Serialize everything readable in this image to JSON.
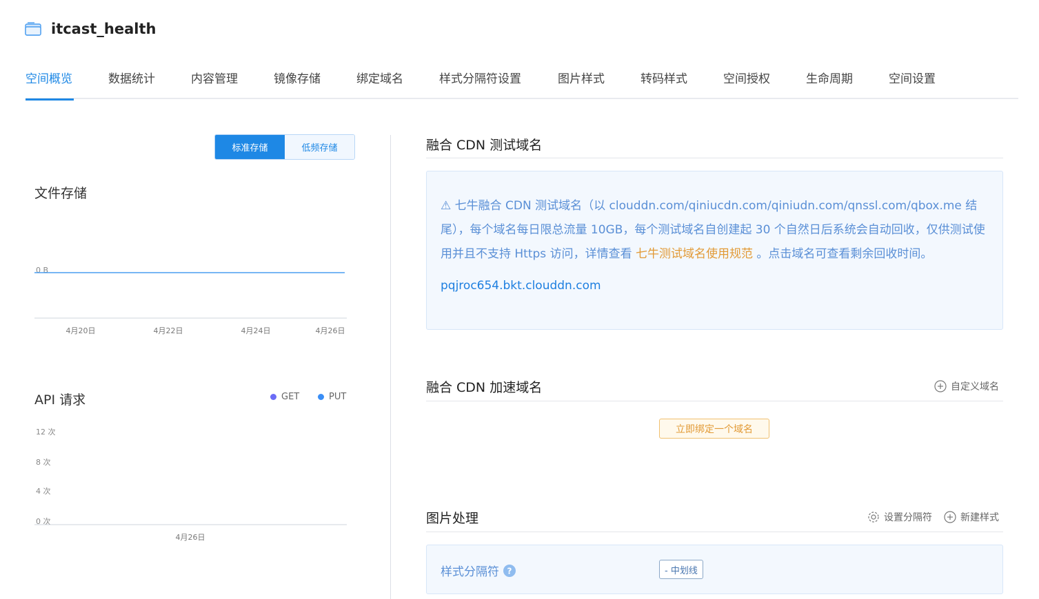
{
  "bucket": {
    "name": "itcast_health",
    "icon": "bucket-icon"
  },
  "tabs": [
    {
      "label": "空间概览",
      "active": true
    },
    {
      "label": "数据统计"
    },
    {
      "label": "内容管理"
    },
    {
      "label": "镜像存储"
    },
    {
      "label": "绑定域名"
    },
    {
      "label": "样式分隔符设置"
    },
    {
      "label": "图片样式"
    },
    {
      "label": "转码样式"
    },
    {
      "label": "空间授权"
    },
    {
      "label": "生命周期"
    },
    {
      "label": "空间设置"
    }
  ],
  "storage_toggle": {
    "standard": "标准存储",
    "low_freq": "低频存储",
    "selected": "标准存储"
  },
  "file_storage": {
    "title": "文件存储"
  },
  "api_requests": {
    "title": "API 请求",
    "legend": [
      {
        "name": "GET",
        "color": "#6b6cf6"
      },
      {
        "name": "PUT",
        "color": "#3a8ef6"
      }
    ]
  },
  "chart_data": [
    {
      "type": "line",
      "title": "文件存储",
      "x": [
        "4月20日",
        "4月22日",
        "4月24日",
        "4月26日"
      ],
      "y_ticks": [
        "0 B"
      ],
      "series": [
        {
          "values": [
            0,
            0,
            0,
            0
          ],
          "color": "#4a9df0"
        }
      ],
      "ylim": [
        0,
        0
      ]
    },
    {
      "type": "line",
      "title": "API 请求",
      "x": [
        "4月26日"
      ],
      "y_ticks": [
        "0 次",
        "4 次",
        "8 次",
        "12 次"
      ],
      "ylim": [
        0,
        12
      ],
      "series": [
        {
          "name": "GET",
          "values": []
        },
        {
          "name": "PUT",
          "values": []
        }
      ]
    }
  ],
  "test_domain": {
    "title": "融合 CDN 测试域名",
    "notice_prefix": "⚠ 七牛融合 CDN 测试域名（以 clouddn.com/qiniucdn.com/qiniudn.com/qnssl.com/qbox.me 结尾），每个域名每日限总流量 10GB，每个测试域名自创建起 30 个自然日后系统会自动回收，仅供测试使用并且不支持 Https 访问，详情查看 ",
    "notice_link": "七牛测试域名使用规范",
    "notice_suffix": " 。点击域名可查看剩余回收时间。",
    "domain": "pqjroc654.bkt.clouddn.com"
  },
  "accel_domain": {
    "title": "融合 CDN 加速域名",
    "custom_link": "自定义域名",
    "bind_button": "立即绑定一个域名"
  },
  "image_processing": {
    "title": "图片处理",
    "set_separator": "设置分隔符",
    "new_style": "新建样式",
    "separator_label": "样式分隔符",
    "separator_value": "- 中划线"
  }
}
